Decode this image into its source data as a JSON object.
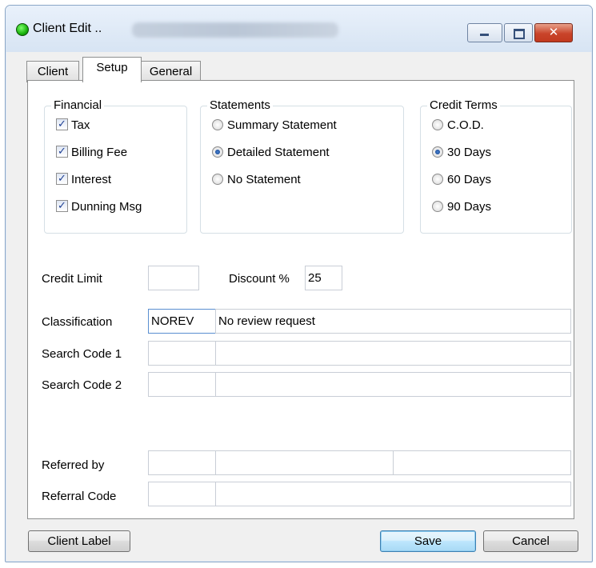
{
  "window": {
    "title": "Client Edit ..",
    "controls": {
      "minimize_icon": "minimize-icon",
      "maximize_icon": "maximize-icon",
      "close_icon": "close-icon",
      "close_glyph": "✕"
    }
  },
  "tabs": [
    {
      "label": "Client"
    },
    {
      "label": "Setup",
      "active": true
    },
    {
      "label": "General"
    }
  ],
  "financial": {
    "title": "Financial",
    "items": [
      {
        "label": "Tax",
        "checked": true
      },
      {
        "label": "Billing Fee",
        "checked": true
      },
      {
        "label": "Interest",
        "checked": true
      },
      {
        "label": "Dunning Msg",
        "checked": true
      }
    ]
  },
  "statements": {
    "title": "Statements",
    "items": [
      {
        "label": "Summary Statement",
        "selected": false
      },
      {
        "label": "Detailed Statement",
        "selected": true
      },
      {
        "label": "No Statement",
        "selected": false
      }
    ]
  },
  "credit_terms": {
    "title": "Credit Terms",
    "items": [
      {
        "label": "C.O.D.",
        "selected": false
      },
      {
        "label": "30 Days",
        "selected": true
      },
      {
        "label": "60 Days",
        "selected": false
      },
      {
        "label": "90 Days",
        "selected": false
      }
    ]
  },
  "fields": {
    "credit_limit_label": "Credit Limit",
    "credit_limit_value": "",
    "discount_label": "Discount %",
    "discount_value": "25",
    "classification_label": "Classification",
    "classification_code": "NOREV",
    "classification_desc": "No review request",
    "search1_label": "Search Code 1",
    "search2_label": "Search Code 2",
    "referred_by_label": "Referred by",
    "referral_code_label": "Referral Code"
  },
  "buttons": {
    "client_label": "Client Label",
    "save": "Save",
    "cancel": "Cancel"
  },
  "colors": {
    "accent": "#3c7fb1",
    "status_green": "#19b20c",
    "close_red": "#c9442a"
  }
}
